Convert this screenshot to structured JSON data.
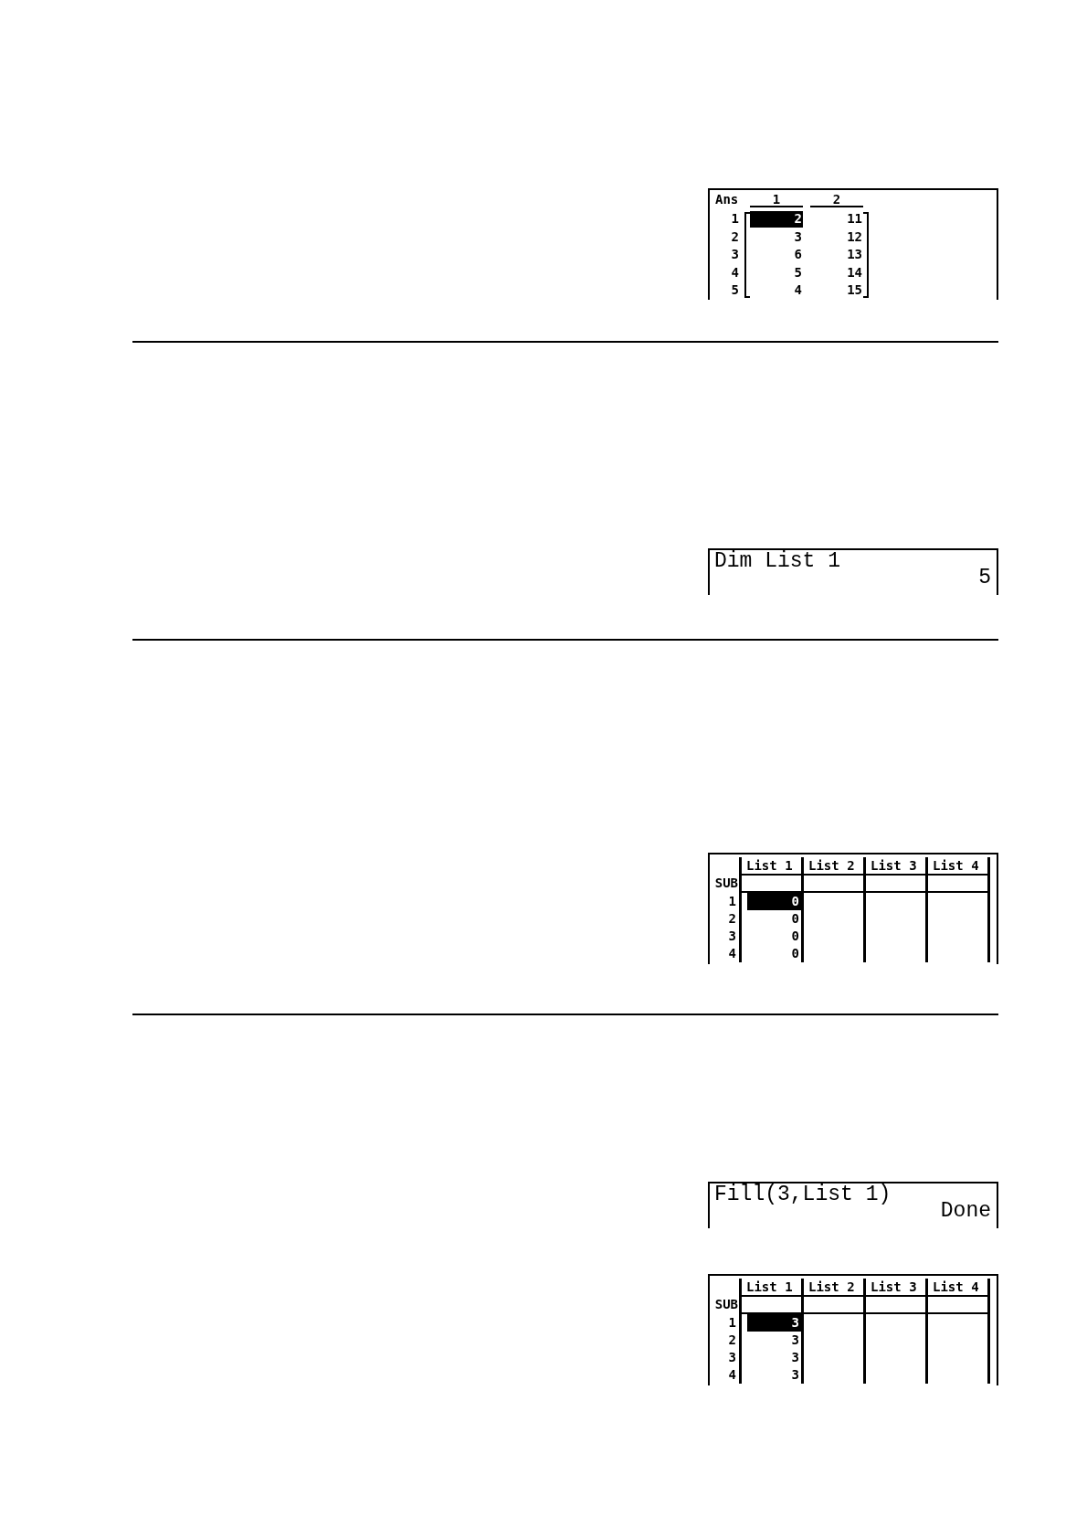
{
  "sections": [
    {
      "screens": [
        {
          "kind": "matrix",
          "name": "Ans",
          "columns": [
            "1",
            "2"
          ],
          "rows": [
            {
              "label": "1",
              "cells": [
                {
                  "value": "2",
                  "selected": true
                },
                {
                  "value": "11",
                  "selected": false
                }
              ]
            },
            {
              "label": "2",
              "cells": [
                {
                  "value": "3",
                  "selected": false
                },
                {
                  "value": "12",
                  "selected": false
                }
              ]
            },
            {
              "label": "3",
              "cells": [
                {
                  "value": "6",
                  "selected": false
                },
                {
                  "value": "13",
                  "selected": false
                }
              ]
            },
            {
              "label": "4",
              "cells": [
                {
                  "value": "5",
                  "selected": false
                },
                {
                  "value": "14",
                  "selected": false
                }
              ]
            },
            {
              "label": "5",
              "cells": [
                {
                  "value": "4",
                  "selected": false
                },
                {
                  "value": "15",
                  "selected": false
                }
              ]
            }
          ]
        }
      ]
    },
    {
      "screens": [
        {
          "kind": "text",
          "input": "Dim List 1",
          "result": "5"
        }
      ]
    },
    {
      "screens": [
        {
          "kind": "list",
          "sub_label": "SUB",
          "columns": [
            "List 1",
            "List 2",
            "List 3",
            "List 4"
          ],
          "rows": [
            {
              "label": "1",
              "cells": [
                {
                  "value": "0",
                  "selected": true
                }
              ]
            },
            {
              "label": "2",
              "cells": [
                {
                  "value": "0",
                  "selected": false
                }
              ]
            },
            {
              "label": "3",
              "cells": [
                {
                  "value": "0",
                  "selected": false
                }
              ]
            },
            {
              "label": "4",
              "cells": [
                {
                  "value": "0",
                  "selected": false
                }
              ]
            }
          ]
        }
      ]
    },
    {
      "screens": [
        {
          "kind": "text",
          "input": "Fill(3,List 1)",
          "result": "Done"
        },
        {
          "kind": "list",
          "sub_label": "SUB",
          "columns": [
            "List 1",
            "List 2",
            "List 3",
            "List 4"
          ],
          "rows": [
            {
              "label": "1",
              "cells": [
                {
                  "value": "3",
                  "selected": true
                }
              ]
            },
            {
              "label": "2",
              "cells": [
                {
                  "value": "3",
                  "selected": false
                }
              ]
            },
            {
              "label": "3",
              "cells": [
                {
                  "value": "3",
                  "selected": false
                }
              ]
            },
            {
              "label": "4",
              "cells": [
                {
                  "value": "3",
                  "selected": false
                }
              ]
            }
          ]
        }
      ]
    }
  ]
}
